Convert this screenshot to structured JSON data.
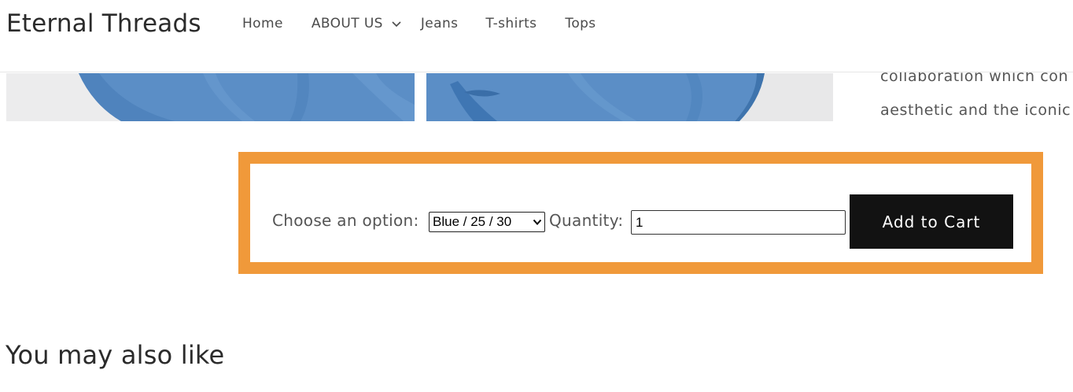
{
  "header": {
    "logo": "Eternal Threads",
    "nav": {
      "home": "Home",
      "about": "ABOUT US",
      "jeans": "Jeans",
      "tshirts": "T-shirts",
      "tops": "Tops"
    }
  },
  "gallery": {
    "photo_colors": {
      "denim": "#5b8ec6",
      "background": "#e9e9ea"
    }
  },
  "description": {
    "line1": "collaboration which con",
    "line2": "aesthetic and the iconic"
  },
  "cart": {
    "option_label": "Choose an option:",
    "selected_option": "Blue / 25 / 30",
    "quantity_label": "Quantity:",
    "quantity_value": "1",
    "add_to_cart": "Add to Cart",
    "highlight_color": "#f0993a"
  },
  "recommendations": {
    "title": "You may also like"
  }
}
